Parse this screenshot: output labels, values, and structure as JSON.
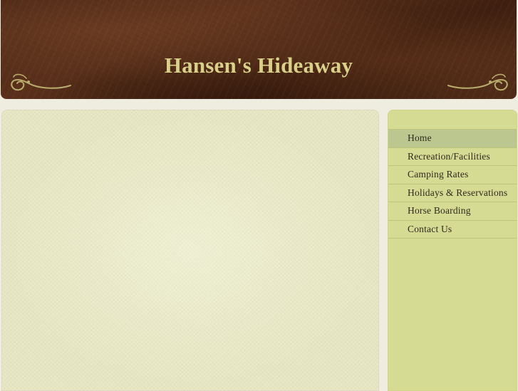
{
  "header": {
    "title": "Hansen's Hideaway"
  },
  "nav": {
    "items": [
      {
        "label": "Home",
        "active": true
      },
      {
        "label": "Recreation/Facilities",
        "active": false
      },
      {
        "label": "Camping Rates",
        "active": false
      },
      {
        "label": "Holidays & Reservations",
        "active": false
      },
      {
        "label": "Horse Boarding",
        "active": false
      },
      {
        "label": "Contact Us",
        "active": false
      }
    ]
  },
  "colors": {
    "header_bg": "#4a2614",
    "title_text": "#d9d08a",
    "sidebar_bg": "#d6db93",
    "nav_active_bg": "#bcc78f",
    "content_bg": "#e8e8c6",
    "page_bg": "#efece0"
  },
  "icons": {
    "flourish_left": "ornamental-flourish-icon",
    "flourish_right": "ornamental-flourish-icon"
  }
}
